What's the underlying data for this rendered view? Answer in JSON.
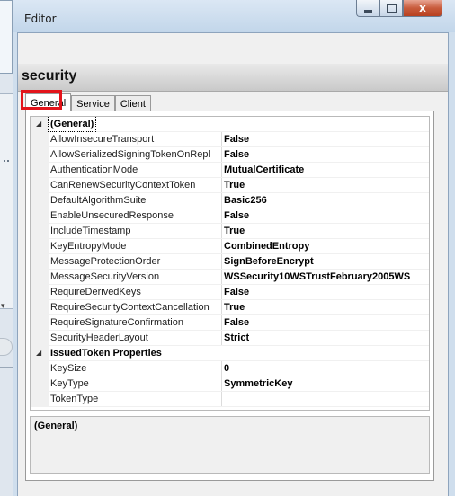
{
  "window": {
    "title": "Editor"
  },
  "header": {
    "title": "security"
  },
  "tabs": [
    {
      "label": "General",
      "active": true
    },
    {
      "label": "Service",
      "active": false
    },
    {
      "label": "Client",
      "active": false
    }
  ],
  "grid": {
    "categories": [
      {
        "label": "(General)",
        "expanded": true,
        "rows": [
          {
            "name": "AllowInsecureTransport",
            "value": "False"
          },
          {
            "name": "AllowSerializedSigningTokenOnRepl",
            "value": "False"
          },
          {
            "name": "AuthenticationMode",
            "value": "MutualCertificate"
          },
          {
            "name": "CanRenewSecurityContextToken",
            "value": "True"
          },
          {
            "name": "DefaultAlgorithmSuite",
            "value": "Basic256"
          },
          {
            "name": "EnableUnsecuredResponse",
            "value": "False"
          },
          {
            "name": "IncludeTimestamp",
            "value": "True"
          },
          {
            "name": "KeyEntropyMode",
            "value": "CombinedEntropy"
          },
          {
            "name": "MessageProtectionOrder",
            "value": "SignBeforeEncrypt"
          },
          {
            "name": "MessageSecurityVersion",
            "value": "WSSecurity10WSTrustFebruary2005WS"
          },
          {
            "name": "RequireDerivedKeys",
            "value": "False"
          },
          {
            "name": "RequireSecurityContextCancellation",
            "value": "True"
          },
          {
            "name": "RequireSignatureConfirmation",
            "value": "False"
          },
          {
            "name": "SecurityHeaderLayout",
            "value": "Strict"
          }
        ]
      },
      {
        "label": "IssuedToken Properties",
        "expanded": true,
        "rows": [
          {
            "name": "KeySize",
            "value": "0"
          },
          {
            "name": "KeyType",
            "value": "SymmetricKey"
          },
          {
            "name": "TokenType",
            "value": ""
          }
        ]
      }
    ]
  },
  "description": {
    "title": "(General)"
  },
  "caption": {
    "close_glyph": "x"
  },
  "icons": {
    "expanded": "collapse-triangle-icon"
  },
  "colors": {
    "highlight": "#e3141b",
    "title_gradient": "#c2d6ea"
  }
}
